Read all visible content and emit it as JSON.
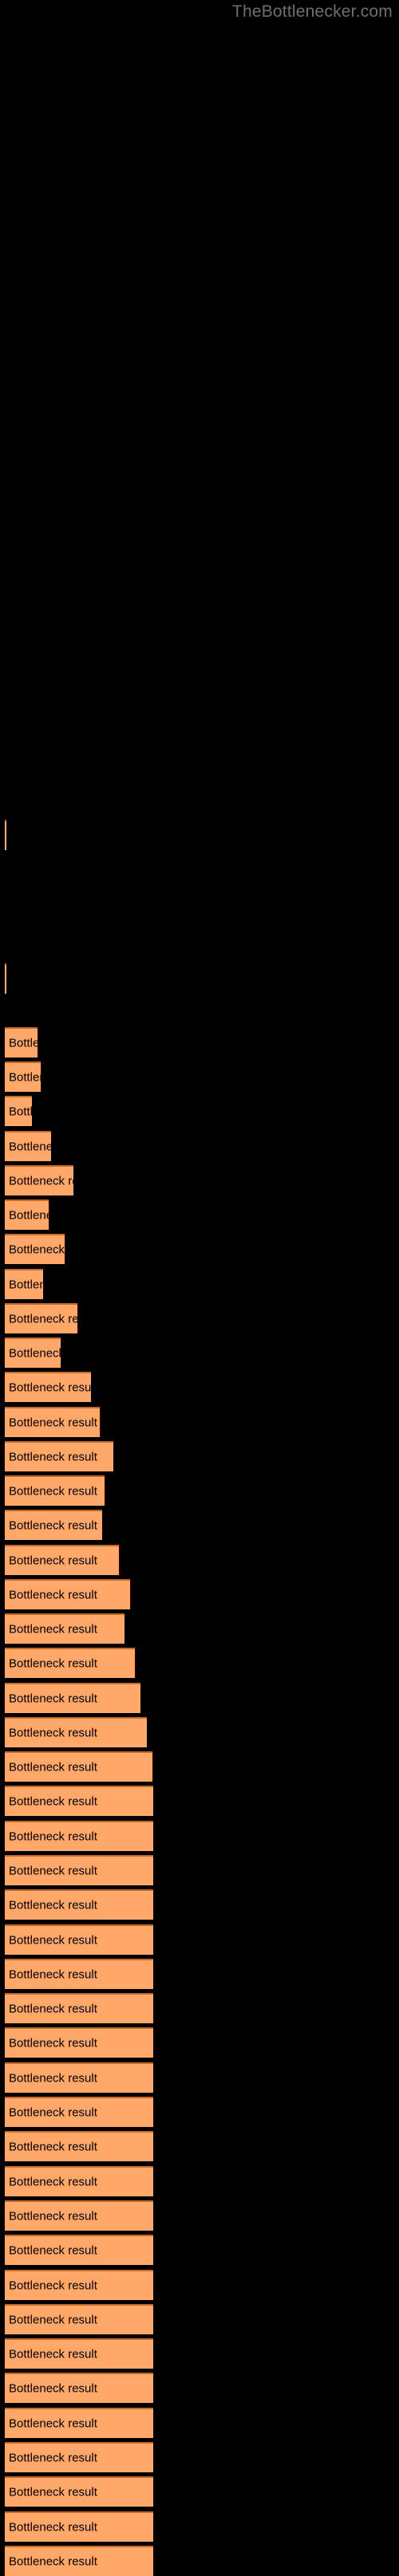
{
  "site": {
    "title": "TheBottlenecker.com"
  },
  "background_color": "#000000",
  "chart_data": {
    "type": "bar",
    "orientation": "horizontal",
    "title": "",
    "subtitle": "",
    "xlabel": "",
    "ylabel": "",
    "grid": false,
    "legend": null,
    "bar_color": "#ffa869",
    "bar_border_color": "#c76a26",
    "label_color": "#000000",
    "bar_label_text": "Bottleneck result",
    "categories": [
      "Bottleneck result",
      "Bottleneck result",
      "Bottleneck result",
      "Bottleneck result",
      "Bottleneck result",
      "Bottleneck result",
      "Bottleneck result",
      "Bottleneck result",
      "Bottleneck result",
      "Bottleneck result",
      "Bottleneck result",
      "Bottleneck result",
      "Bottleneck result",
      "Bottleneck result",
      "Bottleneck result",
      "Bottleneck result",
      "Bottleneck result",
      "Bottleneck result",
      "Bottleneck result",
      "Bottleneck result",
      "Bottleneck result",
      "Bottleneck result",
      "Bottleneck result",
      "Bottleneck result"
    ],
    "values": [
      2,
      2,
      41,
      45,
      34,
      58,
      86,
      55,
      75,
      48,
      91,
      70,
      108,
      119,
      136,
      125,
      122,
      143,
      157,
      150,
      163,
      170,
      178,
      185
    ],
    "xlim": [
      0,
      500
    ],
    "bar_tops": [
      1028,
      1208,
      1288,
      1331,
      1374,
      1418,
      1461,
      1504,
      1547,
      1591,
      1634,
      1677,
      1720,
      1764,
      1807,
      1850,
      1893,
      1937,
      1980,
      2023,
      2066,
      2110,
      2153,
      2196
    ]
  },
  "bars": [
    {
      "name": "bar-1",
      "label": "Bottleneck result",
      "top": 1028,
      "width": 2,
      "visible_label": ""
    },
    {
      "name": "bar-2",
      "label": "Bottleneck result",
      "top": 1208,
      "width": 2,
      "visible_label": ""
    },
    {
      "name": "bar-3",
      "label": "Bottleneck result",
      "top": 1288,
      "width": 41,
      "visible_label": "Bottl"
    },
    {
      "name": "bar-4",
      "label": "Bottleneck result",
      "top": 1331,
      "width": 45,
      "visible_label": "Bottlen"
    },
    {
      "name": "bar-5",
      "label": "Bottleneck result",
      "top": 1374,
      "width": 34,
      "visible_label": "Bottle"
    },
    {
      "name": "bar-6",
      "label": "Bottleneck result",
      "top": 1418,
      "width": 58,
      "visible_label": "Bottleneck"
    },
    {
      "name": "bar-7",
      "label": "Bottleneck result",
      "top": 1461,
      "width": 86,
      "visible_label": "Bottleneck res"
    },
    {
      "name": "bar-8",
      "label": "Bottleneck result",
      "top": 1504,
      "width": 55,
      "visible_label": "Bottleneck"
    },
    {
      "name": "bar-9",
      "label": "Bottleneck result",
      "top": 1547,
      "width": 75,
      "visible_label": "Bottleneck re"
    },
    {
      "name": "bar-10",
      "label": "Bottleneck result",
      "top": 1591,
      "width": 48,
      "visible_label": "Bottlenec"
    },
    {
      "name": "bar-11",
      "label": "Bottleneck result",
      "top": 1634,
      "width": 91,
      "visible_label": "Bottleneck resu"
    },
    {
      "name": "bar-12",
      "label": "Bottleneck result",
      "top": 1677,
      "width": 70,
      "visible_label": "Bottleneck r"
    },
    {
      "name": "bar-13",
      "label": "Bottleneck result",
      "top": 1720,
      "width": 108,
      "visible_label": "Bottleneck result"
    },
    {
      "name": "bar-14",
      "label": "Bottleneck result",
      "top": 1764,
      "width": 119,
      "visible_label": "Bottleneck result"
    },
    {
      "name": "bar-15",
      "label": "Bottleneck result",
      "top": 1807,
      "width": 136,
      "visible_label": "Bottleneck result"
    },
    {
      "name": "bar-16",
      "label": "Bottleneck result",
      "top": 1850,
      "width": 125,
      "visible_label": "Bottleneck result"
    },
    {
      "name": "bar-17",
      "label": "Bottleneck result",
      "top": 1893,
      "width": 122,
      "visible_label": "Bottleneck result"
    },
    {
      "name": "bar-18",
      "label": "Bottleneck result",
      "top": 1937,
      "width": 143,
      "visible_label": "Bottleneck result"
    },
    {
      "name": "bar-19",
      "label": "Bottleneck result",
      "top": 1980,
      "width": 157,
      "visible_label": "Bottleneck result"
    },
    {
      "name": "bar-20",
      "label": "Bottleneck result",
      "top": 2023,
      "width": 150,
      "visible_label": "Bottleneck result"
    },
    {
      "name": "bar-21",
      "label": "Bottleneck result",
      "top": 2066,
      "width": 163,
      "visible_label": "Bottleneck result"
    },
    {
      "name": "bar-22",
      "label": "Bottleneck result",
      "top": 2110,
      "width": 170,
      "visible_label": "Bottleneck result"
    },
    {
      "name": "bar-23",
      "label": "Bottleneck result",
      "top": 2153,
      "width": 178,
      "visible_label": "Bottleneck result"
    },
    {
      "name": "bar-24",
      "label": "Bottleneck result",
      "top": 2196,
      "width": 185,
      "visible_label": "Bottleneck result"
    }
  ]
}
